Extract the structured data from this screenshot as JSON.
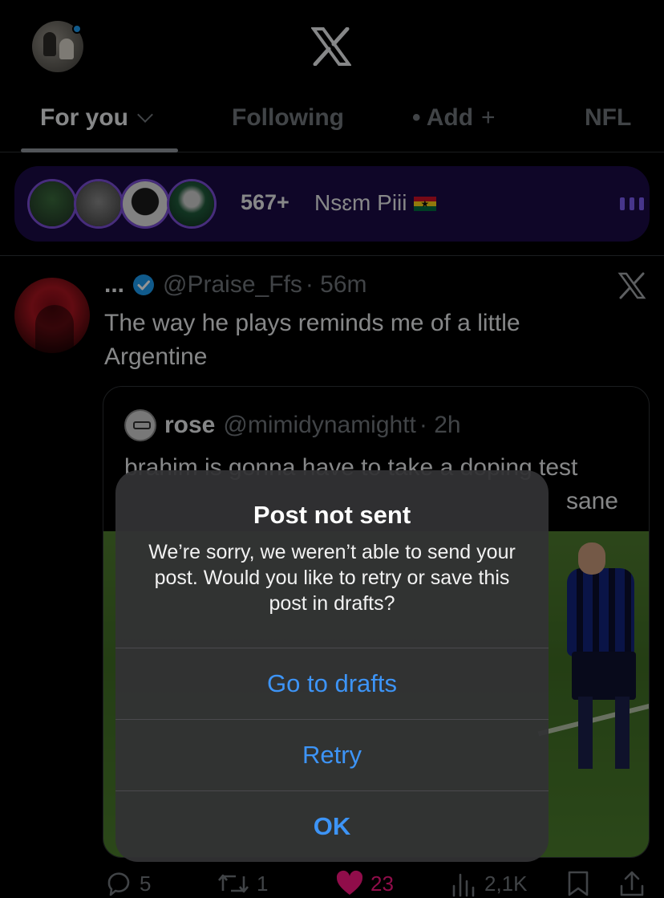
{
  "header": {
    "logo_icon": "x-logo-icon",
    "profile_avatar_icon": "profile-avatar",
    "notification_dot_color": "#1d9bf0"
  },
  "tabs": [
    {
      "label": "For you",
      "active": true
    },
    {
      "label": "Following",
      "active": false
    },
    {
      "label": "• Add",
      "suffix": "+",
      "active": false
    },
    {
      "label": "NFL",
      "active": false
    }
  ],
  "space": {
    "listener_count": "567+",
    "name": "Nsɛm Piii",
    "flag_icon": "ghana-flag-icon",
    "bg_color": "#1b0b45",
    "accent_color": "#7b4fd6"
  },
  "post": {
    "name": "...",
    "handle": "@Praise_Ffs",
    "time": "· 56m",
    "text": "The way he plays reminds me of a little Argentine",
    "quote": {
      "name": "rose",
      "handle": "@mimidynamightt",
      "time": "· 2h",
      "text_line1": "brahim is gonna have to take a doping test",
      "text_line2": "sane"
    }
  },
  "actions": {
    "replies": "5",
    "reposts": "1",
    "likes": "23",
    "views": "2,1K"
  },
  "alert": {
    "title": "Post not sent",
    "message": "We’re sorry, we weren’t able to send your post. Would you like to retry or save this post in drafts?",
    "buttons": [
      "Go to drafts",
      "Retry",
      "OK"
    ],
    "button_color": "#3d94f6"
  }
}
